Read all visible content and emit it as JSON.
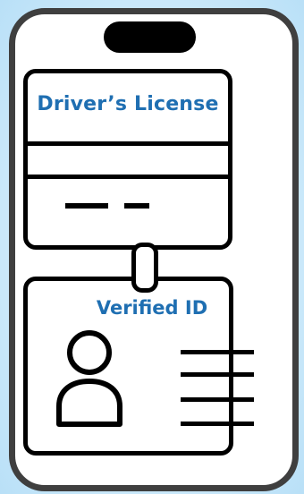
{
  "license_card": {
    "title": "Driver’s License"
  },
  "verified_badge": {
    "title": "Verified ID"
  },
  "colors": {
    "accent_text": "#1f6fb2",
    "phone_frame": "#3f3f3f",
    "background": "#d2ecfb"
  },
  "icons": [
    "phone-notch-icon",
    "person-icon",
    "text-lines-icon",
    "badge-clip-icon"
  ]
}
